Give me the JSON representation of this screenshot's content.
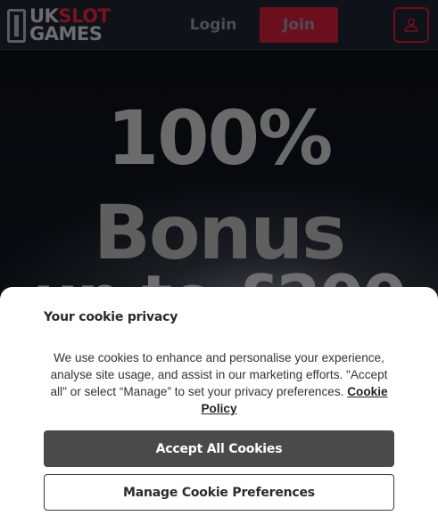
{
  "header": {
    "logo": {
      "line1_a": "UK",
      "line1_b": "SLOT",
      "line2": "GAMES"
    },
    "login_label": "Login",
    "join_label": "Join",
    "account_icon": "user-icon"
  },
  "hero": {
    "line1": "100%",
    "line2": "Bonus",
    "line3": "up to £200"
  },
  "cookie": {
    "title": "Your cookie privacy",
    "body": "We use cookies to enhance and personalise your experience, analyse site usage, and assist in our marketing efforts. \"Accept all\" or select “Manage” to set your privacy preferences.",
    "policy_link": "Cookie Policy",
    "accept_label": "Accept All Cookies",
    "manage_label": "Manage Cookie Preferences"
  },
  "colors": {
    "header_bg": "#0f1219",
    "brand_red": "#6b0f1d",
    "accept_bg": "#4a4a4a"
  }
}
